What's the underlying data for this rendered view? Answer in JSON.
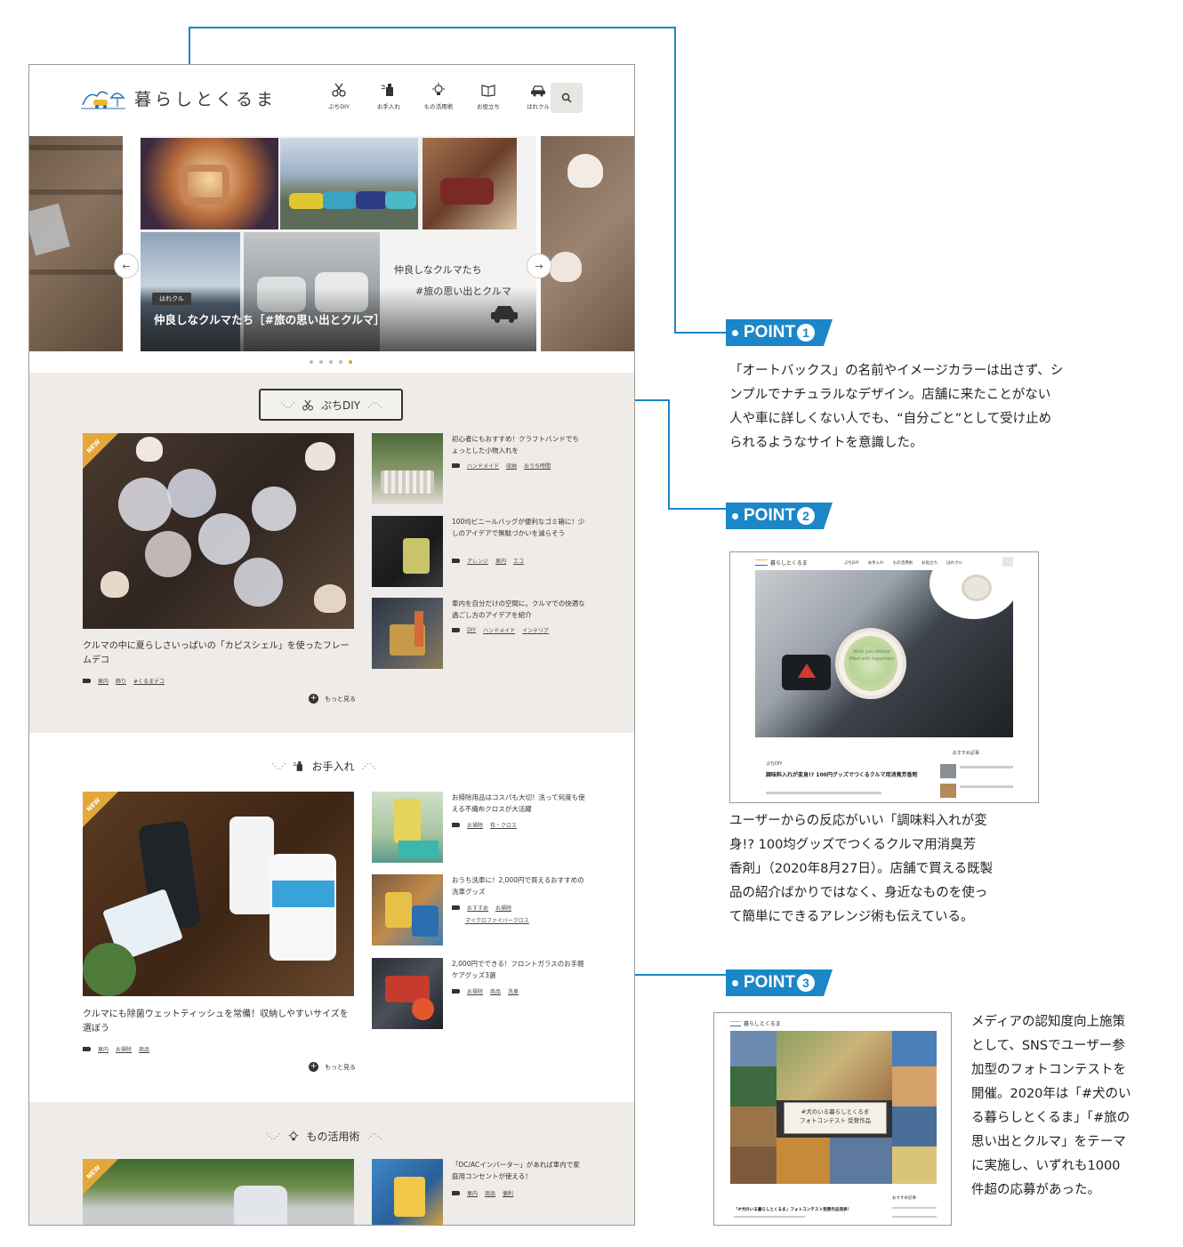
{
  "site": {
    "logo_text": "暮らしとくるま",
    "nav": [
      {
        "label": "ぷちDIY",
        "icon": "scissors-icon"
      },
      {
        "label": "お手入れ",
        "icon": "cleaning-spray-icon"
      },
      {
        "label": "もの活用術",
        "icon": "lightbulb-icon"
      },
      {
        "label": "お役立ち",
        "icon": "book-icon"
      },
      {
        "label": "はれクル",
        "icon": "car-icon"
      }
    ],
    "search_icon": "search-icon",
    "hero": {
      "badge": "はれクル",
      "title": "仲良しなクルマたち［#旅の思い出とクルマ］",
      "overlay_line1": "仲良しなクルマたち",
      "overlay_line2": "#旅の思い出とクルマ",
      "prev": "←",
      "next": "→"
    },
    "sections": [
      {
        "title": "ぷちDIY",
        "icon": "scissors-icon",
        "feature": {
          "badge": "NEW",
          "title": "クルマの中に夏らしさいっぱいの「カピスシェル」を使ったフレームデコ",
          "tags": [
            "車内",
            "飾り",
            "#くるまデコ"
          ]
        },
        "articles": [
          {
            "title": "初心者にもおすすめ！クラフトバンドでちょっとした小物入れを",
            "tags": [
              "ハンドメイド",
              "収納",
              "おうち時間"
            ]
          },
          {
            "title": "100均ビニールバッグが便利なゴミ箱に！少しのアイデアで無駄づかいを減らそう",
            "tags": [
              "アレンジ",
              "車内",
              "エコ"
            ]
          },
          {
            "title": "車内を自分だけの空間に。クルマでの快適な過ごし方のアイデアを紹介",
            "tags": [
              "DIY",
              "ハンドメイド",
              "インテリア"
            ]
          }
        ],
        "more": "もっと見る"
      },
      {
        "title": "お手入れ",
        "icon": "cleaning-spray-icon",
        "feature": {
          "badge": "NEW",
          "title": "クルマにも除菌ウェットティッシュを常備！収納しやすいサイズを選ぼう",
          "tags": [
            "車内",
            "お掃除",
            "商品"
          ]
        },
        "articles": [
          {
            "title": "お掃除用品はコスパも大切！洗って何度も使える不織布クロスが大活躍",
            "tags": [
              "お掃除",
              "布・クロス"
            ]
          },
          {
            "title": "おうち洗車に！2,000円で買えるおすすめの洗車グッズ",
            "tags": [
              "おすすめ",
              "お掃除",
              "マイクロファイバークロス"
            ]
          },
          {
            "title": "2,000円でできる！フロントガラスのお手軽ケアグッズ3選",
            "tags": [
              "お掃除",
              "商品",
              "洗車"
            ]
          }
        ],
        "more": "もっと見る"
      },
      {
        "title": "もの活用術",
        "icon": "lightbulb-icon",
        "feature": {
          "badge": "NEW"
        },
        "articles": [
          {
            "title": "「DC/ACインバーター」があれば車内で家庭用コンセントが使える！",
            "tags": [
              "車内",
              "商品",
              "便利"
            ]
          }
        ]
      }
    ]
  },
  "points": [
    {
      "label": "POINT",
      "number": "1",
      "text": [
        "「オートバックス」の名前やイメージカラーは出さず、シ",
        "ンプルでナチュラルなデザイン。店舗に来たことがない",
        "人や車に詳しくない人でも、“自分ごと”として受け止め",
        "られるようなサイトを意識した。"
      ]
    },
    {
      "label": "POINT",
      "number": "2",
      "text": [
        "ユーザーからの反応がいい「調味料入れが変",
        "身!? 100均グッズでつくるクルマ用消臭芳",
        "香剤」（2020年8月27日）。店舗で買える既製",
        "品の紹介ばかりではなく、身近なものを使っ",
        "て簡単にできるアレンジ術も伝えている。"
      ],
      "thumb": {
        "logo": "暮らしとくるま",
        "nav": [
          "ぷちDIY",
          "お手入れ",
          "もの活用術",
          "お役立ち",
          "はれクル"
        ],
        "badge": "ぷちDIY",
        "title": "調味料入れが変身!? 100円グッズでつくるクルマ用消臭芳香剤",
        "side_heading": "おすすめ記事",
        "sticker_text": "Wish you always filled with happiness"
      }
    },
    {
      "label": "POINT",
      "number": "3",
      "text": [
        "メディアの認知度向上施策",
        "として、SNSでユーザー参",
        "加型のフォトコンテストを",
        "開催。2020年は「#犬のい",
        "る暮らしとくるま」「#旅の",
        "思い出とクルマ」をテーマ",
        "に実施し、いずれも1000",
        "件超の応募があった。"
      ],
      "thumb": {
        "logo": "暮らしとくるま",
        "banner_line1": "#犬のいる暮らしとくるま",
        "banner_line2": "フォトコンテスト 受賞作品",
        "article_title": "「#犬のいる暮らしとくるま」フォトコンテスト受賞作品発表！",
        "side_heading": "おすすめ記事"
      }
    }
  ],
  "colors": {
    "accent": "#1b86c8",
    "section_bg": "#eeebe8",
    "new_badge": "#e3a73a",
    "slider_active": "#e8a21c"
  }
}
